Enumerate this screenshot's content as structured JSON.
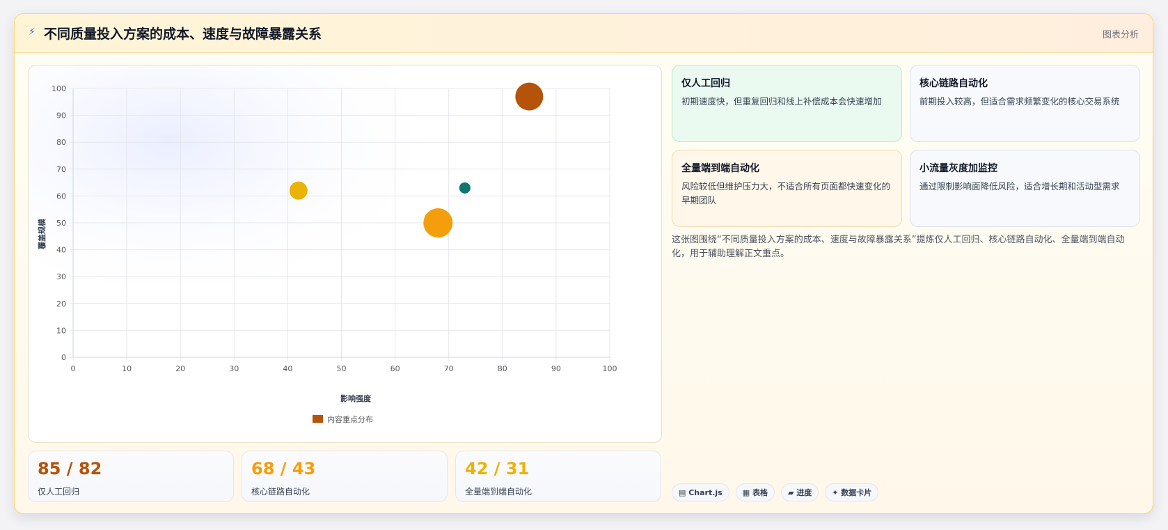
{
  "header": {
    "icon": "lightning-icon",
    "title": "不同质量投入方案的成本、速度与故障暴露关系",
    "tag": "图表分析"
  },
  "chart_data": {
    "type": "scatter",
    "subtype": "bubble",
    "xlabel": "影响强度",
    "ylabel": "覆盖规模",
    "xlim": [
      0,
      100
    ],
    "ylim": [
      0,
      100
    ],
    "xticks": [
      0,
      10,
      20,
      30,
      40,
      50,
      60,
      70,
      80,
      90,
      100
    ],
    "yticks": [
      0,
      10,
      20,
      30,
      40,
      50,
      60,
      70,
      80,
      90,
      100
    ],
    "grid": true,
    "legend_position": "bottom",
    "legend": [
      {
        "label": "内容重点分布",
        "color": "#b45309"
      }
    ],
    "points": [
      {
        "x": 85,
        "y": 97,
        "r": 20,
        "color": "#b45309"
      },
      {
        "x": 42,
        "y": 62,
        "r": 13,
        "color": "#eab308"
      },
      {
        "x": 73,
        "y": 63,
        "r": 8,
        "color": "#0f766e"
      },
      {
        "x": 68,
        "y": 50,
        "r": 21,
        "color": "#f59e0b"
      }
    ]
  },
  "stats": [
    {
      "value": "85 / 82",
      "label": "仅人工回归",
      "color": "#b45309"
    },
    {
      "value": "68 / 43",
      "label": "核心链路自动化",
      "color": "#f59e0b"
    },
    {
      "value": "42 / 31",
      "label": "全量端到端自动化",
      "color": "#eab308"
    }
  ],
  "cards": [
    {
      "title": "仅人工回归",
      "desc": "初期速度快，但重复回归和线上补偿成本会快速增加",
      "bg": "#eafaf1",
      "border": "#b9ebcc"
    },
    {
      "title": "核心链路自动化",
      "desc": "前期投入较高，但适合需求频繁变化的核心交易系统",
      "bg": "#f7f9fc",
      "border": "#dbe3ee"
    },
    {
      "title": "全量端到端自动化",
      "desc": "风险较低但维护压力大，不适合所有页面都快速变化的早期团队",
      "bg": "#fff7ea",
      "border": "#f4dbae"
    },
    {
      "title": "小流量灰度加监控",
      "desc": "通过限制影响面降低风险，适合增长期和活动型需求",
      "bg": "#f7f9fc",
      "border": "#dbe3ee"
    }
  ],
  "description": "这张图围绕“不同质量投入方案的成本、速度与故障暴露关系”提炼仅人工回归、核心链路自动化、全量端到端自动化，用于辅助理解正文重点。",
  "badges": [
    {
      "icon": "chart-icon",
      "label": "▤ Chart.js"
    },
    {
      "icon": "table-icon",
      "label": "▦ 表格"
    },
    {
      "icon": "progress-icon",
      "label": "▰ 进度"
    },
    {
      "icon": "data-card-icon",
      "label": "✦ 数据卡片"
    }
  ]
}
